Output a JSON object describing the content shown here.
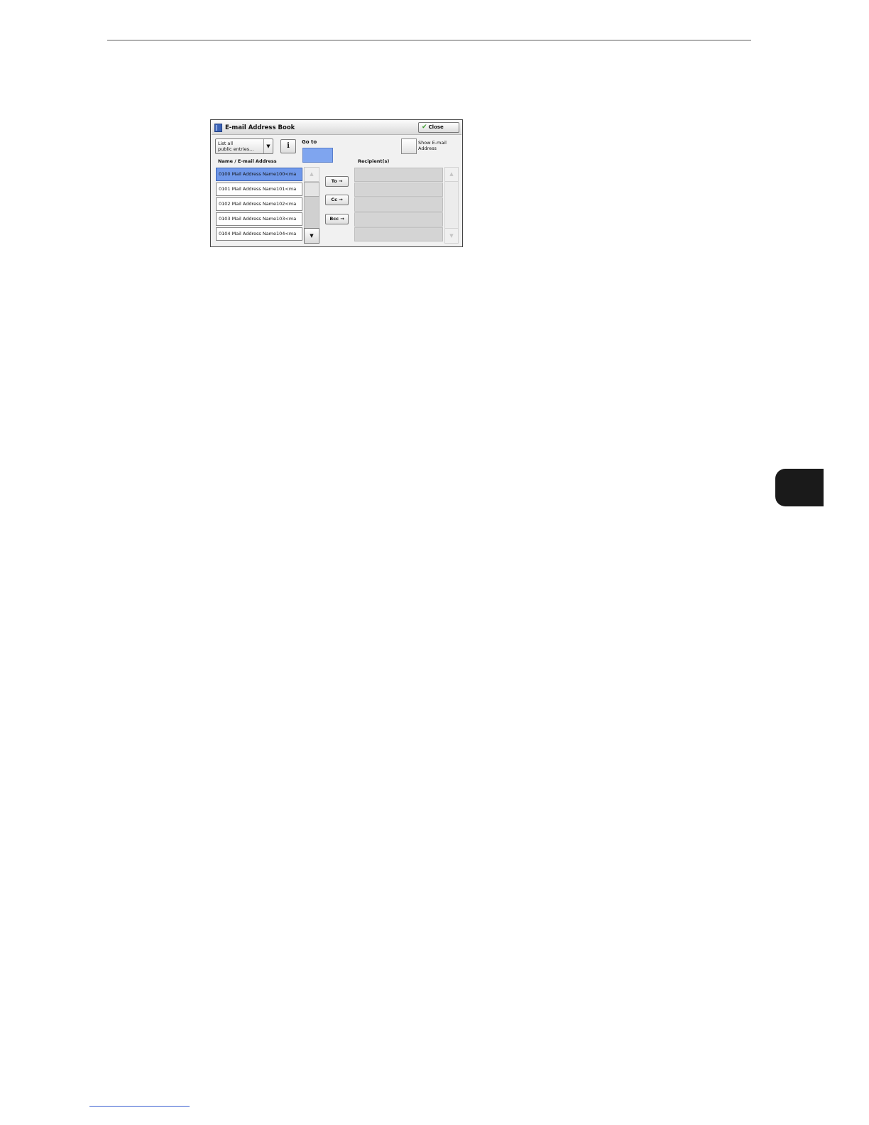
{
  "dialog": {
    "title": "E-mail Address Book",
    "close_label": "Close",
    "filter_dropdown": "List all\npublic entries...",
    "info_glyph": "i",
    "goto_label": "Go to",
    "show_email_label": "Show E-mail\nAddress",
    "name_header": "Name / E-mail Address",
    "recipients_header": "Recipient(s)",
    "entries": [
      "0100  Mail Address Name100<ma",
      "0101  Mail Address Name101<ma",
      "0102  Mail Address Name102<ma",
      "0103  Mail Address Name103<ma",
      "0104  Mail Address Name104<ma"
    ],
    "to_label": "To →",
    "cc_label": "Cc →",
    "bcc_label": "Bcc →",
    "scroll_up_glyph": "▲",
    "scroll_down_glyph": "▼"
  },
  "colors": {
    "selected_entry": "#6f98ea",
    "goto_field": "#7fa5ef",
    "side_tab": "#1a1a1a",
    "link_underline": "#3b5fd1"
  }
}
